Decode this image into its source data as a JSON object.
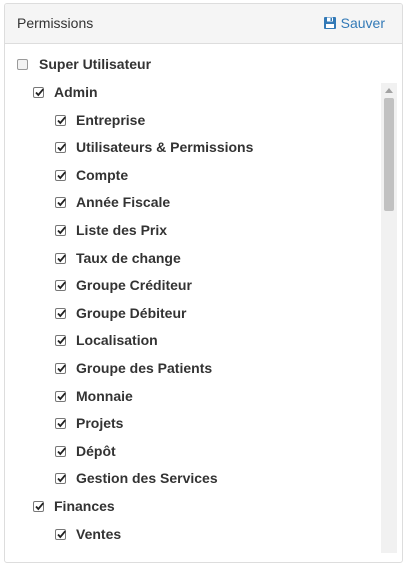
{
  "header": {
    "title": "Permissions",
    "save_label": "Sauver",
    "save_icon": "floppy-disk-icon"
  },
  "permissions": {
    "super": {
      "label": "Super Utilisateur",
      "checked": false
    },
    "admin": {
      "label": "Admin",
      "checked": true,
      "items": [
        {
          "label": "Entreprise",
          "checked": true
        },
        {
          "label": "Utilisateurs & Permissions",
          "checked": true
        },
        {
          "label": "Compte",
          "checked": true
        },
        {
          "label": "Année Fiscale",
          "checked": true
        },
        {
          "label": "Liste des Prix",
          "checked": true
        },
        {
          "label": "Taux de change",
          "checked": true
        },
        {
          "label": "Groupe Créditeur",
          "checked": true
        },
        {
          "label": "Groupe Débiteur",
          "checked": true
        },
        {
          "label": "Localisation",
          "checked": true
        },
        {
          "label": "Groupe des Patients",
          "checked": true
        },
        {
          "label": "Monnaie",
          "checked": true
        },
        {
          "label": "Projets",
          "checked": true
        },
        {
          "label": "Dépôt",
          "checked": true
        },
        {
          "label": "Gestion des Services",
          "checked": true
        }
      ]
    },
    "finances": {
      "label": "Finances",
      "checked": true,
      "items": [
        {
          "label": "Ventes",
          "checked": true
        }
      ]
    }
  },
  "colors": {
    "accent": "#337ab7",
    "heading_bg": "#f5f5f5",
    "border": "#dddddd"
  }
}
